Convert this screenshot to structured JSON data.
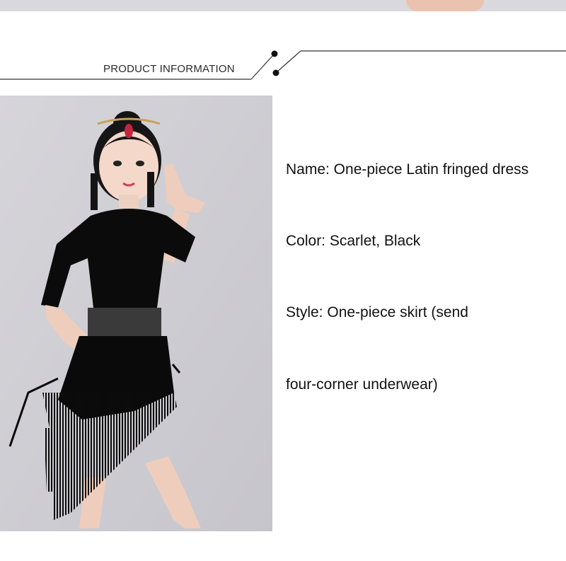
{
  "section": {
    "title": "PRODUCT INFORMATION"
  },
  "product": {
    "name_line": "Name: One-piece Latin fringed dress",
    "color_line": "Color: Scarlet, Black",
    "style_line_1": "Style: One-piece skirt (send",
    "style_line_2": "four-corner underwear)"
  },
  "icons": {
    "header_dot": "bullet-dot-icon"
  },
  "colors": {
    "photo_background": "#cfced3",
    "dress": "#0a0a0a",
    "text": "#111111"
  }
}
